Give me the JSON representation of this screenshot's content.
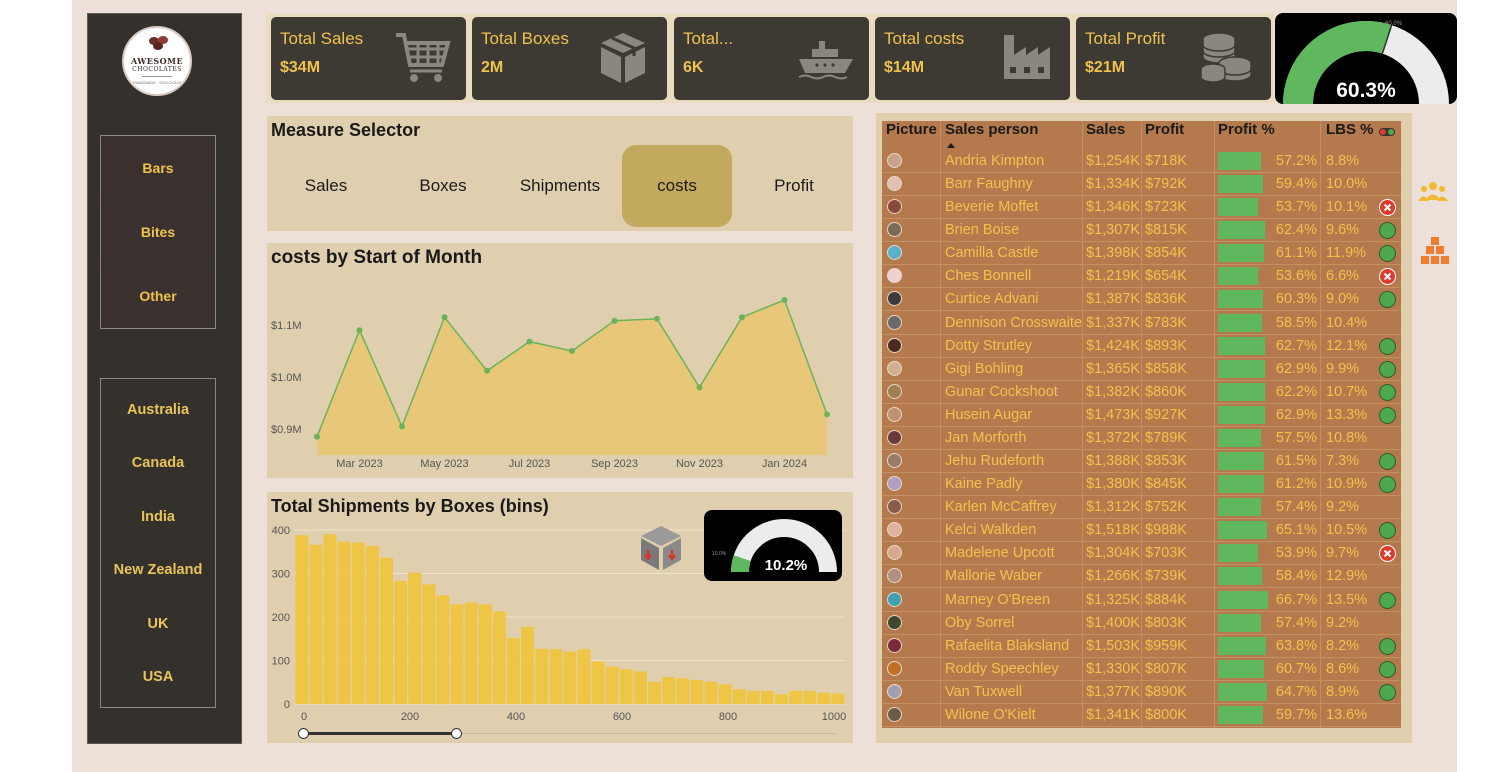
{
  "logo": {
    "line1": "AWESOME",
    "line2": "CHOCOLATES",
    "line3": "HANDMADE · DELICIOUS"
  },
  "categories": [
    "Bars",
    "Bites",
    "Other"
  ],
  "countries": [
    "Australia",
    "Canada",
    "India",
    "New Zealand",
    "UK",
    "USA"
  ],
  "kpis": [
    {
      "label": "Total Sales",
      "value": "$34M",
      "icon": "cart-icon"
    },
    {
      "label": "Total Boxes",
      "value": "2M",
      "icon": "box-icon"
    },
    {
      "label": "Total...",
      "value": "6K",
      "icon": "ship-icon"
    },
    {
      "label": "Total costs",
      "value": "$14M",
      "icon": "factory-icon"
    },
    {
      "label": "Total Profit",
      "value": "$21M",
      "icon": "coins-icon"
    }
  ],
  "profit_gauge": {
    "value": "60.3%",
    "small_label": "60.0%",
    "fraction": 0.603,
    "target_fraction": 0.6
  },
  "measure_selector": {
    "title": "Measure Selector",
    "options": [
      "Sales",
      "Boxes",
      "Shipments",
      "costs",
      "Profit"
    ],
    "selected": "costs"
  },
  "costs_chart_title": "costs by Start of Month",
  "shipments_chart_title": "Total Shipments by Boxes (bins)",
  "lbs_gauge": {
    "value": "10.2%",
    "small_label": "10.0%",
    "fraction": 0.102
  },
  "chart_data": [
    {
      "type": "area",
      "title": "costs by Start of Month",
      "x": [
        "2023-02",
        "2023-03",
        "2023-04",
        "2023-05",
        "2023-06",
        "2023-07",
        "2023-08",
        "2023-09",
        "2023-10",
        "2023-11",
        "2023-12",
        "2024-01",
        "2024-02"
      ],
      "values": [
        0.885,
        1.09,
        0.905,
        1.115,
        1.012,
        1.068,
        1.05,
        1.108,
        1.112,
        0.98,
        1.115,
        1.148,
        0.928
      ],
      "y_unit": "M",
      "ylim": [
        0.85,
        1.2
      ],
      "yticks": [
        "$0.9M",
        "$1.0M",
        "$1.1M"
      ],
      "ytick_values": [
        0.9,
        1.0,
        1.1
      ],
      "xticks": [
        "Mar 2023",
        "May 2023",
        "Jul 2023",
        "Sep 2023",
        "Nov 2023",
        "Jan 2024"
      ],
      "xtick_index": [
        1,
        3,
        5,
        7,
        9,
        11
      ],
      "color": "#e8c878",
      "line_color": "#6ab35a"
    },
    {
      "type": "bar",
      "title": "Total Shipments by Boxes (bins)",
      "bin_width": 20,
      "x": [
        0,
        20,
        40,
        60,
        80,
        100,
        120,
        140,
        160,
        180,
        200,
        220,
        240,
        260,
        280,
        300,
        320,
        340,
        360,
        380,
        400,
        420,
        440,
        460,
        480,
        500,
        520,
        540,
        560,
        580,
        600,
        620,
        640,
        660,
        680,
        700,
        720,
        740,
        760,
        780,
        800,
        820,
        840,
        860,
        880,
        900,
        920,
        940,
        960,
        980,
        1000
      ],
      "values": [
        388,
        366,
        390,
        373,
        371,
        363,
        336,
        283,
        302,
        275,
        250,
        229,
        233,
        229,
        213,
        152,
        177,
        127,
        126,
        120,
        126,
        98,
        86,
        80,
        75,
        51,
        62,
        59,
        55,
        51,
        45,
        34,
        30,
        30,
        22,
        30,
        30,
        26,
        24
      ],
      "xticks": [
        "0",
        "200",
        "400",
        "600",
        "800",
        "1000"
      ],
      "xtick_values": [
        0,
        200,
        400,
        600,
        800,
        1000
      ],
      "yticks": [
        "0",
        "100",
        "200",
        "300",
        "400"
      ],
      "ytick_values": [
        0,
        100,
        200,
        300,
        400
      ],
      "ylim": [
        0,
        400
      ],
      "color": "#eec544"
    }
  ],
  "table": {
    "headers": [
      "Picture",
      "Sales person",
      "Sales",
      "Profit",
      "Profit %",
      "LBS %"
    ],
    "rows": [
      {
        "name": "Andria Kimpton",
        "sales": "$1,254K",
        "profit": "$718K",
        "pct": "57.2%",
        "p": 0.572,
        "lbs": "8.8%",
        "status": ""
      },
      {
        "name": "Barr Faughny",
        "sales": "$1,334K",
        "profit": "$792K",
        "pct": "59.4%",
        "p": 0.594,
        "lbs": "10.0%",
        "status": ""
      },
      {
        "name": "Beverie Moffet",
        "sales": "$1,346K",
        "profit": "$723K",
        "pct": "53.7%",
        "p": 0.537,
        "lbs": "10.1%",
        "status": "bad"
      },
      {
        "name": "Brien Boise",
        "sales": "$1,307K",
        "profit": "$815K",
        "pct": "62.4%",
        "p": 0.624,
        "lbs": "9.6%",
        "status": "ok"
      },
      {
        "name": "Camilla Castle",
        "sales": "$1,398K",
        "profit": "$854K",
        "pct": "61.1%",
        "p": 0.611,
        "lbs": "11.9%",
        "status": "ok"
      },
      {
        "name": "Ches Bonnell",
        "sales": "$1,219K",
        "profit": "$654K",
        "pct": "53.6%",
        "p": 0.536,
        "lbs": "6.6%",
        "status": "bad"
      },
      {
        "name": "Curtice Advani",
        "sales": "$1,387K",
        "profit": "$836K",
        "pct": "60.3%",
        "p": 0.603,
        "lbs": "9.0%",
        "status": "ok"
      },
      {
        "name": "Dennison Crosswaite",
        "sales": "$1,337K",
        "profit": "$783K",
        "pct": "58.5%",
        "p": 0.585,
        "lbs": "10.4%",
        "status": ""
      },
      {
        "name": "Dotty Strutley",
        "sales": "$1,424K",
        "profit": "$893K",
        "pct": "62.7%",
        "p": 0.627,
        "lbs": "12.1%",
        "status": "ok"
      },
      {
        "name": "Gigi Bohling",
        "sales": "$1,365K",
        "profit": "$858K",
        "pct": "62.9%",
        "p": 0.629,
        "lbs": "9.9%",
        "status": "ok"
      },
      {
        "name": "Gunar Cockshoot",
        "sales": "$1,382K",
        "profit": "$860K",
        "pct": "62.2%",
        "p": 0.622,
        "lbs": "10.7%",
        "status": "ok"
      },
      {
        "name": "Husein Augar",
        "sales": "$1,473K",
        "profit": "$927K",
        "pct": "62.9%",
        "p": 0.629,
        "lbs": "13.3%",
        "status": "ok"
      },
      {
        "name": "Jan Morforth",
        "sales": "$1,372K",
        "profit": "$789K",
        "pct": "57.5%",
        "p": 0.575,
        "lbs": "10.8%",
        "status": ""
      },
      {
        "name": "Jehu Rudeforth",
        "sales": "$1,388K",
        "profit": "$853K",
        "pct": "61.5%",
        "p": 0.615,
        "lbs": "7.3%",
        "status": "ok"
      },
      {
        "name": "Kaine Padly",
        "sales": "$1,380K",
        "profit": "$845K",
        "pct": "61.2%",
        "p": 0.612,
        "lbs": "10.9%",
        "status": "ok"
      },
      {
        "name": "Karlen McCaffrey",
        "sales": "$1,312K",
        "profit": "$752K",
        "pct": "57.4%",
        "p": 0.574,
        "lbs": "9.2%",
        "status": ""
      },
      {
        "name": "Kelci Walkden",
        "sales": "$1,518K",
        "profit": "$988K",
        "pct": "65.1%",
        "p": 0.651,
        "lbs": "10.5%",
        "status": "ok"
      },
      {
        "name": "Madelene Upcott",
        "sales": "$1,304K",
        "profit": "$703K",
        "pct": "53.9%",
        "p": 0.539,
        "lbs": "9.7%",
        "status": "bad"
      },
      {
        "name": "Mallorie Waber",
        "sales": "$1,266K",
        "profit": "$739K",
        "pct": "58.4%",
        "p": 0.584,
        "lbs": "12.9%",
        "status": ""
      },
      {
        "name": "Marney O'Breen",
        "sales": "$1,325K",
        "profit": "$884K",
        "pct": "66.7%",
        "p": 0.667,
        "lbs": "13.5%",
        "status": "ok"
      },
      {
        "name": "Oby Sorrel",
        "sales": "$1,400K",
        "profit": "$803K",
        "pct": "57.4%",
        "p": 0.574,
        "lbs": "9.2%",
        "status": ""
      },
      {
        "name": "Rafaelita Blaksland",
        "sales": "$1,503K",
        "profit": "$959K",
        "pct": "63.8%",
        "p": 0.638,
        "lbs": "8.2%",
        "status": "ok"
      },
      {
        "name": "Roddy Speechley",
        "sales": "$1,330K",
        "profit": "$807K",
        "pct": "60.7%",
        "p": 0.607,
        "lbs": "8.6%",
        "status": "ok"
      },
      {
        "name": "Van Tuxwell",
        "sales": "$1,377K",
        "profit": "$890K",
        "pct": "64.7%",
        "p": 0.647,
        "lbs": "8.9%",
        "status": "ok"
      },
      {
        "name": "Wilone O'Kielt",
        "sales": "$1,341K",
        "profit": "$800K",
        "pct": "59.7%",
        "p": 0.597,
        "lbs": "13.6%",
        "status": ""
      }
    ]
  },
  "colors": {
    "accent": "#f0c24b",
    "dark": "#34302c",
    "table_bg": "#b47a4e",
    "positive": "#5fb85e",
    "negative": "#e03a2f"
  }
}
